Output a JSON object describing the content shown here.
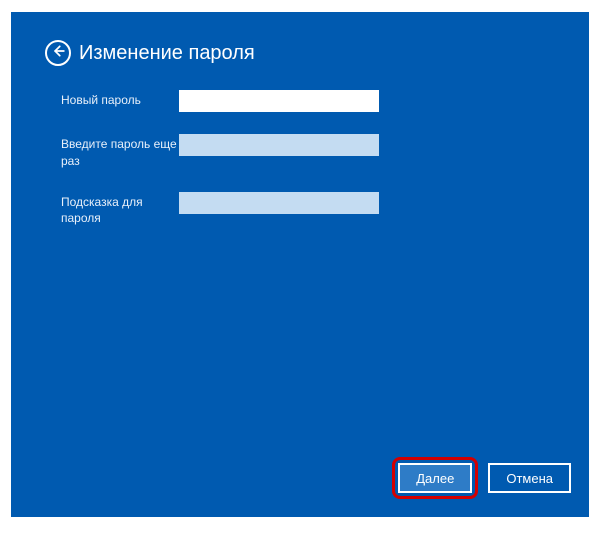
{
  "header": {
    "title": "Изменение пароля"
  },
  "form": {
    "newPassword": {
      "label": "Новый пароль",
      "value": ""
    },
    "confirmPassword": {
      "label": "Введите пароль еще раз",
      "value": ""
    },
    "hint": {
      "label": "Подсказка для пароля",
      "value": ""
    }
  },
  "buttons": {
    "next": "Далее",
    "cancel": "Отмена"
  }
}
